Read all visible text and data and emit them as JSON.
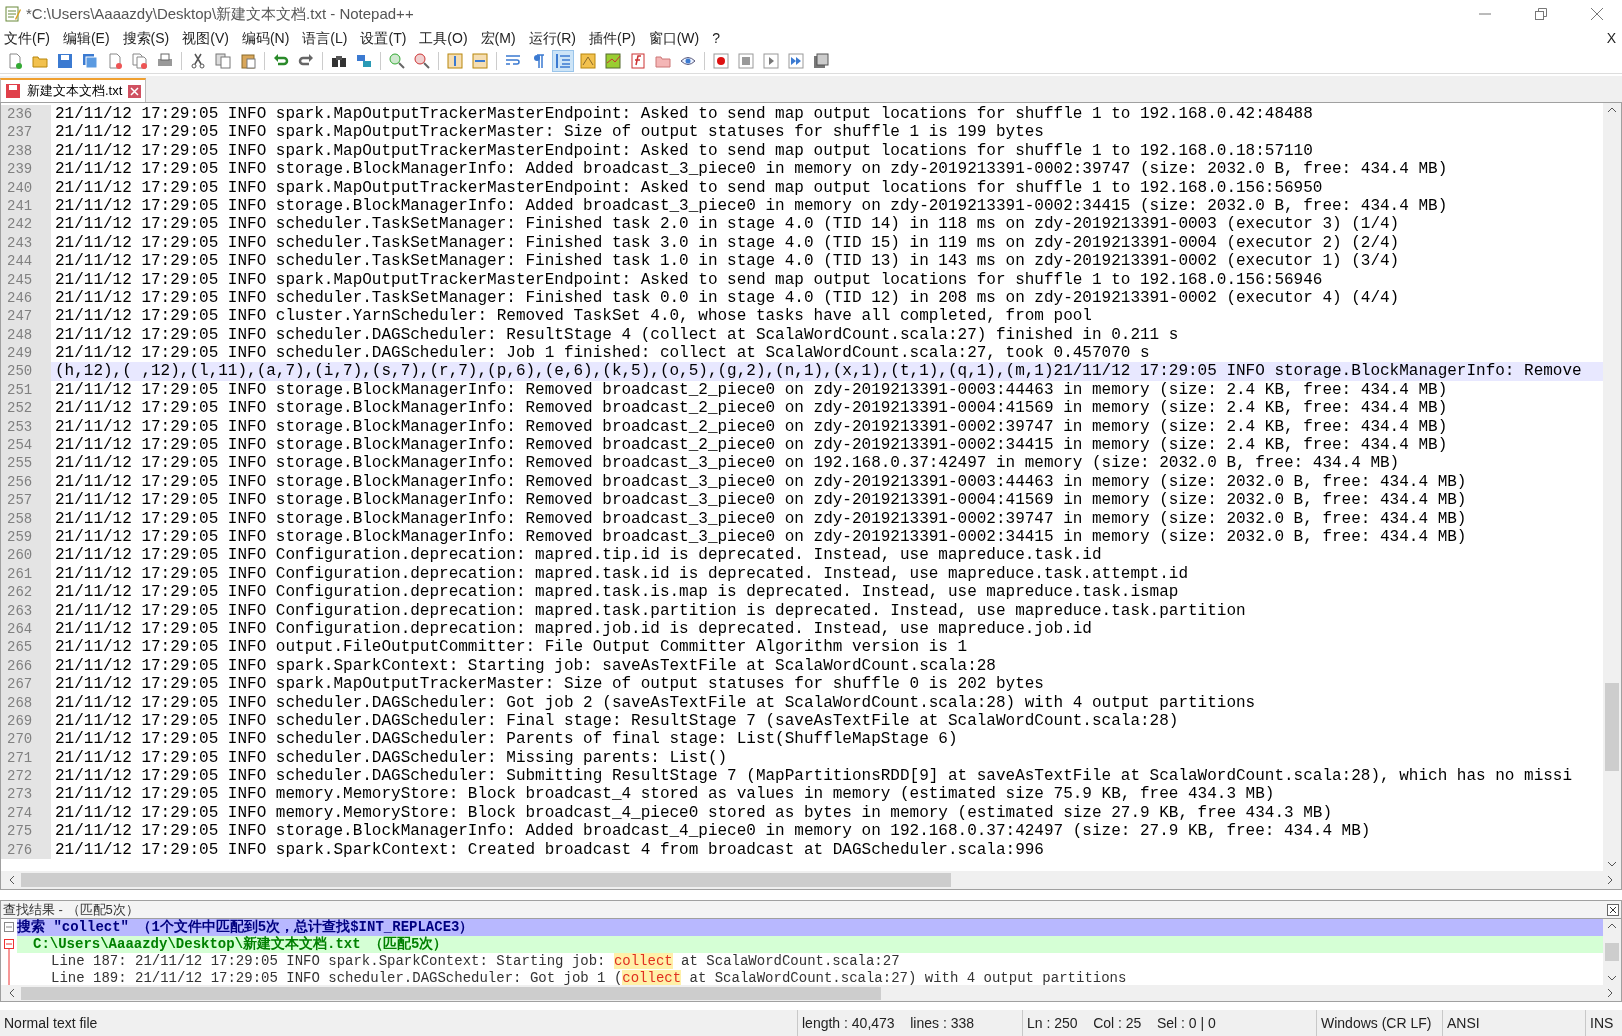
{
  "window": {
    "title": "*C:\\Users\\Aaaazdy\\Desktop\\新建文本文档.txt - Notepad++",
    "close_document": "X"
  },
  "menu": [
    "文件(F)",
    "编辑(E)",
    "搜索(S)",
    "视图(V)",
    "编码(N)",
    "语言(L)",
    "设置(T)",
    "工具(O)",
    "宏(M)",
    "运行(R)",
    "插件(P)",
    "窗口(W)",
    "?"
  ],
  "toolbar": [
    {
      "kind": "new",
      "pressed": false
    },
    {
      "kind": "open",
      "pressed": false
    },
    {
      "kind": "save",
      "pressed": false
    },
    {
      "kind": "save-all",
      "pressed": false
    },
    {
      "kind": "close",
      "pressed": false
    },
    {
      "kind": "close-all",
      "pressed": false
    },
    {
      "kind": "print",
      "pressed": false
    },
    {
      "kind": "separator"
    },
    {
      "kind": "cut",
      "pressed": false
    },
    {
      "kind": "copy",
      "pressed": false
    },
    {
      "kind": "paste",
      "pressed": false
    },
    {
      "kind": "separator"
    },
    {
      "kind": "undo",
      "pressed": false
    },
    {
      "kind": "redo",
      "pressed": false
    },
    {
      "kind": "separator"
    },
    {
      "kind": "find",
      "pressed": false
    },
    {
      "kind": "replace",
      "pressed": false
    },
    {
      "kind": "separator"
    },
    {
      "kind": "zoom-in",
      "pressed": false
    },
    {
      "kind": "zoom-out",
      "pressed": false
    },
    {
      "kind": "separator"
    },
    {
      "kind": "sync-v",
      "pressed": false
    },
    {
      "kind": "sync-h",
      "pressed": false
    },
    {
      "kind": "separator"
    },
    {
      "kind": "wrap",
      "pressed": false
    },
    {
      "kind": "all-chars",
      "pressed": false
    },
    {
      "kind": "indent",
      "pressed": true
    },
    {
      "kind": "udl",
      "pressed": false
    },
    {
      "kind": "map",
      "pressed": false
    },
    {
      "kind": "function",
      "pressed": false
    },
    {
      "kind": "folder",
      "pressed": false
    },
    {
      "kind": "monitor",
      "pressed": false
    },
    {
      "kind": "separator"
    },
    {
      "kind": "record",
      "pressed": false
    },
    {
      "kind": "stop",
      "pressed": false
    },
    {
      "kind": "play",
      "pressed": false
    },
    {
      "kind": "play-multi",
      "pressed": false
    },
    {
      "kind": "save-macro",
      "pressed": false
    }
  ],
  "tabs": [
    {
      "label": "新建文本文档.txt",
      "selected": true,
      "modified": true
    }
  ],
  "editor": {
    "lines": [
      {
        "number": "236",
        "text": "21/11/12 17:29:05 INFO spark.MapOutputTrackerMasterEndpoint: Asked to send map output locations for shuffle 1 to 192.168.0.42:48488",
        "selected": false
      },
      {
        "number": "237",
        "text": "21/11/12 17:29:05 INFO spark.MapOutputTrackerMaster: Size of output statuses for shuffle 1 is 199 bytes",
        "selected": false
      },
      {
        "number": "238",
        "text": "21/11/12 17:29:05 INFO spark.MapOutputTrackerMasterEndpoint: Asked to send map output locations for shuffle 1 to 192.168.0.18:57110",
        "selected": false
      },
      {
        "number": "239",
        "text": "21/11/12 17:29:05 INFO storage.BlockManagerInfo: Added broadcast_3_piece0 in memory on zdy-2019213391-0002:39747 (size: 2032.0 B, free: 434.4 MB)",
        "selected": false
      },
      {
        "number": "240",
        "text": "21/11/12 17:29:05 INFO spark.MapOutputTrackerMasterEndpoint: Asked to send map output locations for shuffle 1 to 192.168.0.156:56950",
        "selected": false
      },
      {
        "number": "241",
        "text": "21/11/12 17:29:05 INFO storage.BlockManagerInfo: Added broadcast_3_piece0 in memory on zdy-2019213391-0002:34415 (size: 2032.0 B, free: 434.4 MB)",
        "selected": false
      },
      {
        "number": "242",
        "text": "21/11/12 17:29:05 INFO scheduler.TaskSetManager: Finished task 2.0 in stage 4.0 (TID 14) in 118 ms on zdy-2019213391-0003 (executor 3) (1/4)",
        "selected": false
      },
      {
        "number": "243",
        "text": "21/11/12 17:29:05 INFO scheduler.TaskSetManager: Finished task 3.0 in stage 4.0 (TID 15) in 119 ms on zdy-2019213391-0004 (executor 2) (2/4)",
        "selected": false
      },
      {
        "number": "244",
        "text": "21/11/12 17:29:05 INFO scheduler.TaskSetManager: Finished task 1.0 in stage 4.0 (TID 13) in 143 ms on zdy-2019213391-0002 (executor 1) (3/4)",
        "selected": false
      },
      {
        "number": "245",
        "text": "21/11/12 17:29:05 INFO spark.MapOutputTrackerMasterEndpoint: Asked to send map output locations for shuffle 1 to 192.168.0.156:56946",
        "selected": false
      },
      {
        "number": "246",
        "text": "21/11/12 17:29:05 INFO scheduler.TaskSetManager: Finished task 0.0 in stage 4.0 (TID 12) in 208 ms on zdy-2019213391-0002 (executor 4) (4/4)",
        "selected": false
      },
      {
        "number": "247",
        "text": "21/11/12 17:29:05 INFO cluster.YarnScheduler: Removed TaskSet 4.0, whose tasks have all completed, from pool",
        "selected": false
      },
      {
        "number": "248",
        "text": "21/11/12 17:29:05 INFO scheduler.DAGScheduler: ResultStage 4 (collect at ScalaWordCount.scala:27) finished in 0.211 s",
        "selected": false
      },
      {
        "number": "249",
        "text": "21/11/12 17:29:05 INFO scheduler.DAGScheduler: Job 1 finished: collect at ScalaWordCount.scala:27, took 0.457070 s",
        "selected": false
      },
      {
        "number": "250",
        "text": "(h,12),( ,12),(l,11),(a,7),(i,7),(s,7),(r,7),(p,6),(e,6),(k,5),(o,5),(g,2),(n,1),(x,1),(t,1),(q,1),(m,1)21/11/12 17:29:05 INFO storage.BlockManagerInfo: Remove",
        "selected": true
      },
      {
        "number": "251",
        "text": "21/11/12 17:29:05 INFO storage.BlockManagerInfo: Removed broadcast_2_piece0 on zdy-2019213391-0003:44463 in memory (size: 2.4 KB, free: 434.4 MB)",
        "selected": false
      },
      {
        "number": "252",
        "text": "21/11/12 17:29:05 INFO storage.BlockManagerInfo: Removed broadcast_2_piece0 on zdy-2019213391-0004:41569 in memory (size: 2.4 KB, free: 434.4 MB)",
        "selected": false
      },
      {
        "number": "253",
        "text": "21/11/12 17:29:05 INFO storage.BlockManagerInfo: Removed broadcast_2_piece0 on zdy-2019213391-0002:39747 in memory (size: 2.4 KB, free: 434.4 MB)",
        "selected": false
      },
      {
        "number": "254",
        "text": "21/11/12 17:29:05 INFO storage.BlockManagerInfo: Removed broadcast_2_piece0 on zdy-2019213391-0002:34415 in memory (size: 2.4 KB, free: 434.4 MB)",
        "selected": false
      },
      {
        "number": "255",
        "text": "21/11/12 17:29:05 INFO storage.BlockManagerInfo: Removed broadcast_3_piece0 on 192.168.0.37:42497 in memory (size: 2032.0 B, free: 434.4 MB)",
        "selected": false
      },
      {
        "number": "256",
        "text": "21/11/12 17:29:05 INFO storage.BlockManagerInfo: Removed broadcast_3_piece0 on zdy-2019213391-0003:44463 in memory (size: 2032.0 B, free: 434.4 MB)",
        "selected": false
      },
      {
        "number": "257",
        "text": "21/11/12 17:29:05 INFO storage.BlockManagerInfo: Removed broadcast_3_piece0 on zdy-2019213391-0004:41569 in memory (size: 2032.0 B, free: 434.4 MB)",
        "selected": false
      },
      {
        "number": "258",
        "text": "21/11/12 17:29:05 INFO storage.BlockManagerInfo: Removed broadcast_3_piece0 on zdy-2019213391-0002:39747 in memory (size: 2032.0 B, free: 434.4 MB)",
        "selected": false
      },
      {
        "number": "259",
        "text": "21/11/12 17:29:05 INFO storage.BlockManagerInfo: Removed broadcast_3_piece0 on zdy-2019213391-0002:34415 in memory (size: 2032.0 B, free: 434.4 MB)",
        "selected": false
      },
      {
        "number": "260",
        "text": "21/11/12 17:29:05 INFO Configuration.deprecation: mapred.tip.id is deprecated. Instead, use mapreduce.task.id",
        "selected": false
      },
      {
        "number": "261",
        "text": "21/11/12 17:29:05 INFO Configuration.deprecation: mapred.task.id is deprecated. Instead, use mapreduce.task.attempt.id",
        "selected": false
      },
      {
        "number": "262",
        "text": "21/11/12 17:29:05 INFO Configuration.deprecation: mapred.task.is.map is deprecated. Instead, use mapreduce.task.ismap",
        "selected": false
      },
      {
        "number": "263",
        "text": "21/11/12 17:29:05 INFO Configuration.deprecation: mapred.task.partition is deprecated. Instead, use mapreduce.task.partition",
        "selected": false
      },
      {
        "number": "264",
        "text": "21/11/12 17:29:05 INFO Configuration.deprecation: mapred.job.id is deprecated. Instead, use mapreduce.job.id",
        "selected": false
      },
      {
        "number": "265",
        "text": "21/11/12 17:29:05 INFO output.FileOutputCommitter: File Output Committer Algorithm version is 1",
        "selected": false
      },
      {
        "number": "266",
        "text": "21/11/12 17:29:05 INFO spark.SparkContext: Starting job: saveAsTextFile at ScalaWordCount.scala:28",
        "selected": false
      },
      {
        "number": "267",
        "text": "21/11/12 17:29:05 INFO spark.MapOutputTrackerMaster: Size of output statuses for shuffle 0 is 202 bytes",
        "selected": false
      },
      {
        "number": "268",
        "text": "21/11/12 17:29:05 INFO scheduler.DAGScheduler: Got job 2 (saveAsTextFile at ScalaWordCount.scala:28) with 4 output partitions",
        "selected": false
      },
      {
        "number": "269",
        "text": "21/11/12 17:29:05 INFO scheduler.DAGScheduler: Final stage: ResultStage 7 (saveAsTextFile at ScalaWordCount.scala:28)",
        "selected": false
      },
      {
        "number": "270",
        "text": "21/11/12 17:29:05 INFO scheduler.DAGScheduler: Parents of final stage: List(ShuffleMapStage 6)",
        "selected": false
      },
      {
        "number": "271",
        "text": "21/11/12 17:29:05 INFO scheduler.DAGScheduler: Missing parents: List()",
        "selected": false
      },
      {
        "number": "272",
        "text": "21/11/12 17:29:05 INFO scheduler.DAGScheduler: Submitting ResultStage 7 (MapPartitionsRDD[9] at saveAsTextFile at ScalaWordCount.scala:28), which has no missi",
        "selected": false
      },
      {
        "number": "273",
        "text": "21/11/12 17:29:05 INFO memory.MemoryStore: Block broadcast_4 stored as values in memory (estimated size 75.9 KB, free 434.3 MB)",
        "selected": false
      },
      {
        "number": "274",
        "text": "21/11/12 17:29:05 INFO memory.MemoryStore: Block broadcast_4_piece0 stored as bytes in memory (estimated size 27.9 KB, free 434.3 MB)",
        "selected": false
      },
      {
        "number": "275",
        "text": "21/11/12 17:29:05 INFO storage.BlockManagerInfo: Added broadcast_4_piece0 in memory on 192.168.0.37:42497 (size: 27.9 KB, free: 434.4 MB)",
        "selected": false
      },
      {
        "number": "276",
        "text": "21/11/12 17:29:05 INFO spark.SparkContext: Created broadcast 4 from broadcast at DAGScheduler.scala:996",
        "selected": false
      }
    ]
  },
  "find_results": {
    "title": "查找结果 - （匹配5次）",
    "search_line": "搜索 \"collect\" （1个文件中匹配到5次，总计查找$INT_REPLACE3）",
    "file_line": "C:\\Users\\Aaaazdy\\Desktop\\新建文本文档.txt （匹配5次）",
    "matches": [
      {
        "before": "Line 187: 21/11/12 17:29:05 INFO spark.SparkContext: Starting job: ",
        "match": "collect",
        "after": " at ScalaWordCount.scala:27"
      },
      {
        "before": "Line 189: 21/11/12 17:29:05 INFO scheduler.DAGScheduler: Got job 1 (",
        "match": "collect",
        "after": " at ScalaWordCount.scala:27) with 4 output partitions"
      }
    ]
  },
  "status_bar": {
    "file_type": "Normal text file",
    "size": "length : 40,473    lines : 338",
    "position": "Ln : 250    Col : 25    Sel : 0 | 0",
    "eol": "Windows (CR LF)",
    "encoding": "ANSI",
    "mode": "INS"
  }
}
